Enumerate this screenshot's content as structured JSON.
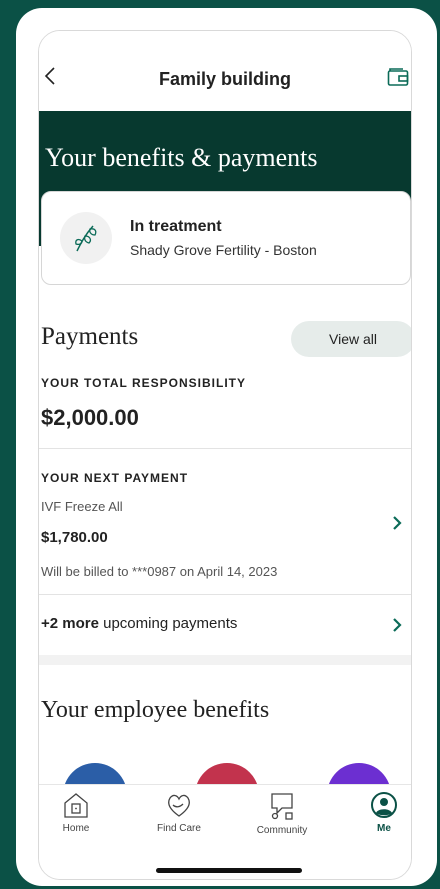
{
  "header": {
    "title": "Family building"
  },
  "hero": {
    "title": "Your benefits & payments"
  },
  "treatment": {
    "status": "In treatment",
    "clinic": "Shady Grove Fertility - Boston"
  },
  "payments": {
    "heading": "Payments",
    "view_all_label": "View all",
    "total_label": "YOUR TOTAL RESPONSIBILITY",
    "total_amount": "$2,000.00",
    "next_label": "YOUR NEXT PAYMENT",
    "next_name": "IVF Freeze All",
    "next_amount": "$1,780.00",
    "next_billed": "Will be billed to  ***0987 on April 14, 2023",
    "more_count": "+2 more",
    "more_text": " upcoming payments"
  },
  "benefits": {
    "heading": "Your employee benefits"
  },
  "tabs": [
    {
      "label": "Home",
      "icon": "home-icon",
      "active": false
    },
    {
      "label": "Find Care",
      "icon": "find-care-icon",
      "active": false
    },
    {
      "label": "Community",
      "icon": "community-icon",
      "active": false
    },
    {
      "label": "Me",
      "icon": "profile-icon",
      "active": true
    }
  ],
  "colors": {
    "brand_dark": "#07392f",
    "brand": "#0b5146",
    "benefit_blue": "#2b5ea7",
    "benefit_red": "#c2334d",
    "benefit_purple": "#6c2fd1"
  }
}
